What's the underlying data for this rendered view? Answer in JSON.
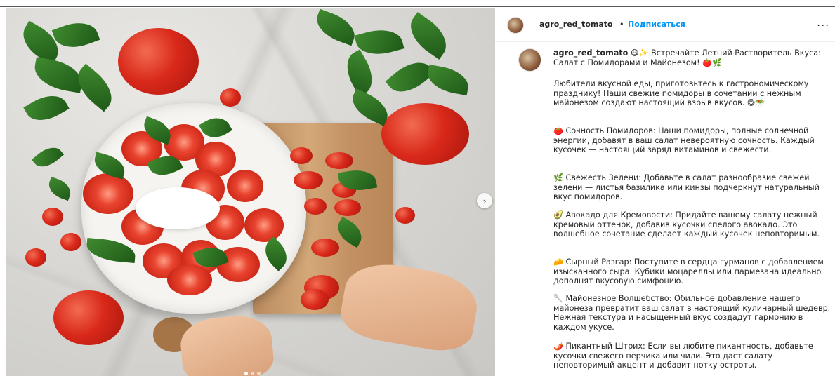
{
  "post": {
    "username": "agro_red_tomato",
    "separator": "•",
    "follow_label": "Подписаться",
    "more_label": "..."
  },
  "carousel": {
    "next_label": "›",
    "current_slide": 1,
    "total_slides": 3
  },
  "caption": {
    "username": "agro_red_tomato",
    "intro": "😷✨ Встречайте Летний Растворитель Вкуса: Салат с Помидорами и Майонезом! 🍅🌿",
    "paragraphs": [
      "Любители вкусной еды, приготовьтесь к гастрономическому празднику! Наши свежие помидоры в сочетании с нежным майонезом создают настоящий взрыв вкусов. 😋🥗",
      "🍅 Сочность Помидоров: Наши помидоры, полные солнечной энергии, добавят в ваш салат невероятную сочность. Каждый кусочек — настоящий заряд витаминов и свежести.",
      "🌿 Свежесть Зелени: Добавьте в салат разнообразие свежей зелени — листья базилика или кинзы подчеркнут натуральный вкус помидоров.",
      "🥑 Авокадо для Кремовости: Придайте вашему салату нежный кремовый оттенок, добавив кусочки спелого авокадо. Это волшебное сочетание сделает каждый кусочек неповторимым.",
      "🧀 Сырный Разгар: Поступите в сердца гурманов с добавлением изысканного сыра. Кубики моцареллы или пармезана идеально дополнят вкусовую симфонию.",
      "🥄 Майонезное Волшебство: Обильное добавление нашего майонеза превратит ваш салат в настоящий кулинарный шедевр. Нежная текстура и насыщенный вкус создадут гармонию в каждом укусе.",
      "🌶️ Пикантный Штрих: Если вы любите пикантность, добавьте кусочки свежего перчика или чили. Это даст салату неповторимый акцент и добавит нотку остроты."
    ]
  }
}
